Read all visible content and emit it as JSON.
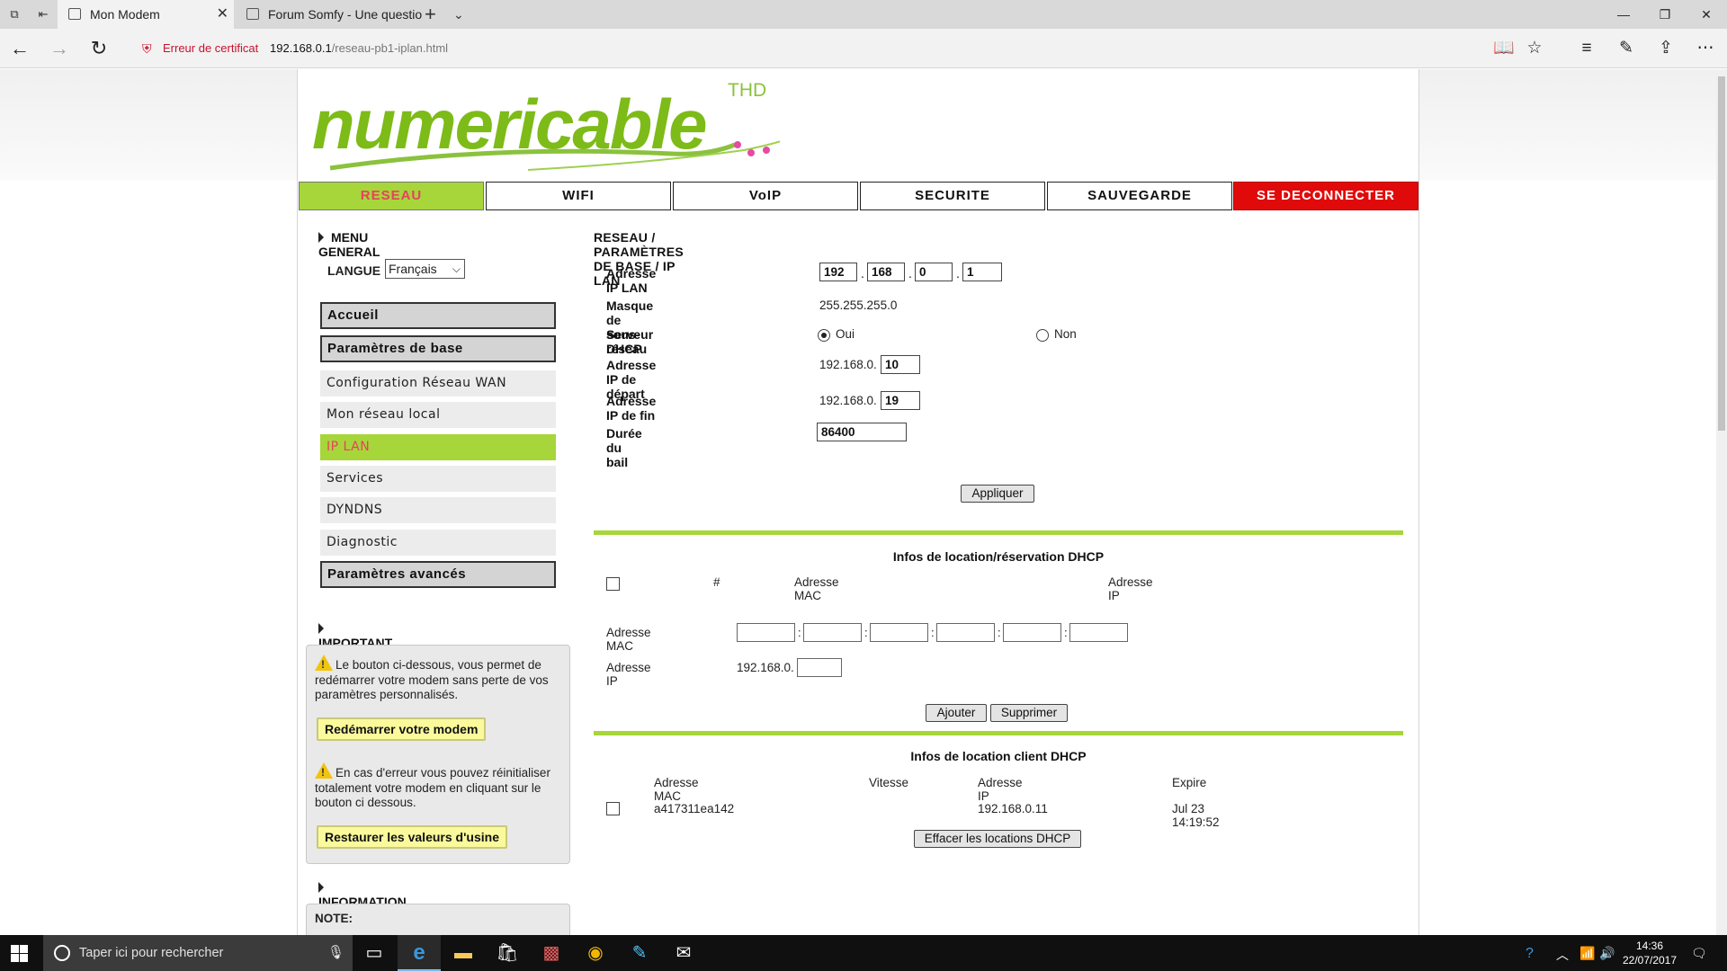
{
  "browser": {
    "tabs": [
      {
        "title": "Mon Modem",
        "active": true
      },
      {
        "title": "Forum Somfy - Une questio",
        "active": false
      }
    ],
    "cert_error": "Erreur de certificat",
    "url_host": "192.168.0.1",
    "url_path": "/reseau-pb1-iplan.html",
    "icons": [
      "back-arrow-icon",
      "forward-arrow-icon",
      "refresh-icon",
      "reading-view-icon",
      "favorite-star-icon",
      "hub-icon",
      "web-note-icon",
      "share-icon",
      "more-icon"
    ]
  },
  "logo": {
    "text": "numericable",
    "thd": "THD"
  },
  "nav": [
    "RESEAU",
    "WIFI",
    "VoIP",
    "SECURITE",
    "SAUVEGARDE",
    "SE DECONNECTER"
  ],
  "sidebar": {
    "menu_general": "MENU GENERAL",
    "langue_label": "LANGUE",
    "langue_value": "Français",
    "items": [
      {
        "label": "Accueil",
        "type": "main"
      },
      {
        "label": "Paramètres de base",
        "type": "main"
      },
      {
        "label": "Configuration Réseau WAN",
        "type": "sub"
      },
      {
        "label": "Mon réseau local",
        "type": "sub"
      },
      {
        "label": "IP LAN",
        "type": "sub",
        "active": true
      },
      {
        "label": "Services",
        "type": "sub"
      },
      {
        "label": "DYNDNS",
        "type": "sub"
      },
      {
        "label": "Diagnostic",
        "type": "sub"
      },
      {
        "label": "Paramètres avancés",
        "type": "main"
      }
    ],
    "important": "IMPORTANT",
    "reboot_text": "Le bouton ci-dessous, vous permet de redémarrer votre modem sans perte de vos paramètres personnalisés.",
    "reboot_btn": "Redémarrer votre modem",
    "reset_text": "En cas d'erreur vous pouvez réinitialiser totalement votre modem en cliquant sur le bouton ci dessous.",
    "reset_btn": "Restaurer les valeurs d'usine",
    "information": "INFORMATION",
    "note": "NOTE:"
  },
  "main": {
    "title": "RESEAU / PARAMÈTRES DE BASE / IP LAN",
    "ip_lan_label": "Adresse IP LAN",
    "ip": [
      "192",
      "168",
      "0",
      "1"
    ],
    "mask_label": "Masque de sous-réseau",
    "mask_value": "255.255.255.0",
    "dhcp_label": "Serveur DHCP",
    "dhcp_oui": "Oui",
    "dhcp_non": "Non",
    "start_label": "Adresse IP de départ",
    "start_prefix": "192.168.0.",
    "start_value": "10",
    "end_label": "Adresse IP de fin",
    "end_prefix": "192.168.0.",
    "end_value": "19",
    "lease_label": "Durée du bail",
    "lease_value": "86400",
    "apply_btn": "Appliquer",
    "reservation": {
      "title": "Infos de location/réservation DHCP",
      "col_num": "#",
      "col_mac": "Adresse MAC",
      "col_ip": "Adresse IP",
      "mac_label": "Adresse MAC",
      "ip_label": "Adresse IP",
      "ip_prefix": "192.168.0.",
      "add_btn": "Ajouter",
      "del_btn": "Supprimer"
    },
    "clients": {
      "title": "Infos de location client DHCP",
      "headers": [
        "Adresse MAC",
        "Vitesse",
        "Adresse IP",
        "Expire"
      ],
      "rows": [
        {
          "mac": "a417311ea142",
          "speed": "",
          "ip": "192.168.0.11",
          "expire": "Jul 23 14:19:52"
        }
      ],
      "clear_btn": "Effacer les locations DHCP"
    }
  },
  "taskbar": {
    "search_placeholder": "Taper ici pour rechercher",
    "apps": [
      "task-view-icon",
      "edge-icon",
      "file-explorer-icon",
      "store-icon",
      "photos-icon",
      "chrome-icon",
      "app-icon",
      "mail-icon"
    ],
    "time": "14:36",
    "date": "22/07/2017"
  }
}
